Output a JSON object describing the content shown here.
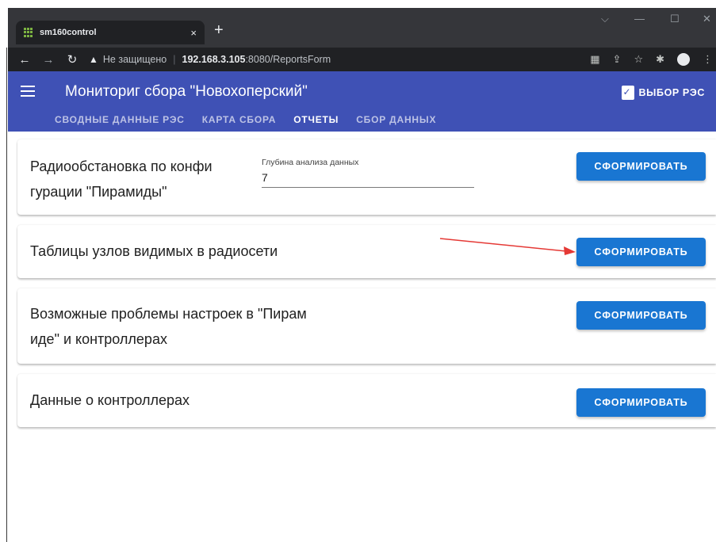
{
  "browser": {
    "tab_title": "sm160control",
    "tab_close": "×",
    "new_tab": "+",
    "address": {
      "security_icon": "warning-triangle-icon",
      "security_label": "Не защищено",
      "host": "192.168.3.105",
      "path": ":8080/ReportsForm"
    }
  },
  "app": {
    "title": "Мониториг сбора \"Новохоперский\"",
    "res_button_label": "ВЫБОР РЭС",
    "tabs": [
      {
        "label": "СВОДНЫЕ ДАННЫЕ РЭС",
        "active": false
      },
      {
        "label": "КАРТА СБОРА",
        "active": false
      },
      {
        "label": "ОТЧЕТЫ",
        "active": true
      },
      {
        "label": "СБОР ДАННЫХ",
        "active": false
      }
    ]
  },
  "reports": [
    {
      "label_line1": "Радиообстановка по конфи",
      "label_line2": "гурации \"Пирамиды\"",
      "depth_caption": "Глубина анализа данных",
      "depth_value": "7",
      "button_label": "СФОРМИРОВАТЬ"
    },
    {
      "label_line1": "Таблицы узлов видимых в радиосети",
      "button_label": "СФОРМИРОВАТЬ"
    },
    {
      "label_line1": "Возможные проблемы настроек в \"Пирам",
      "label_line2": "иде\" и контроллерах",
      "button_label": "СФОРМИРОВАТЬ"
    },
    {
      "label_line1": "Данные о контроллерах",
      "button_label": "СФОРМИРОВАТЬ"
    }
  ],
  "colors": {
    "appbar": "#3f51b5",
    "button": "#1976d2",
    "annotation_arrow": "#e53935"
  }
}
